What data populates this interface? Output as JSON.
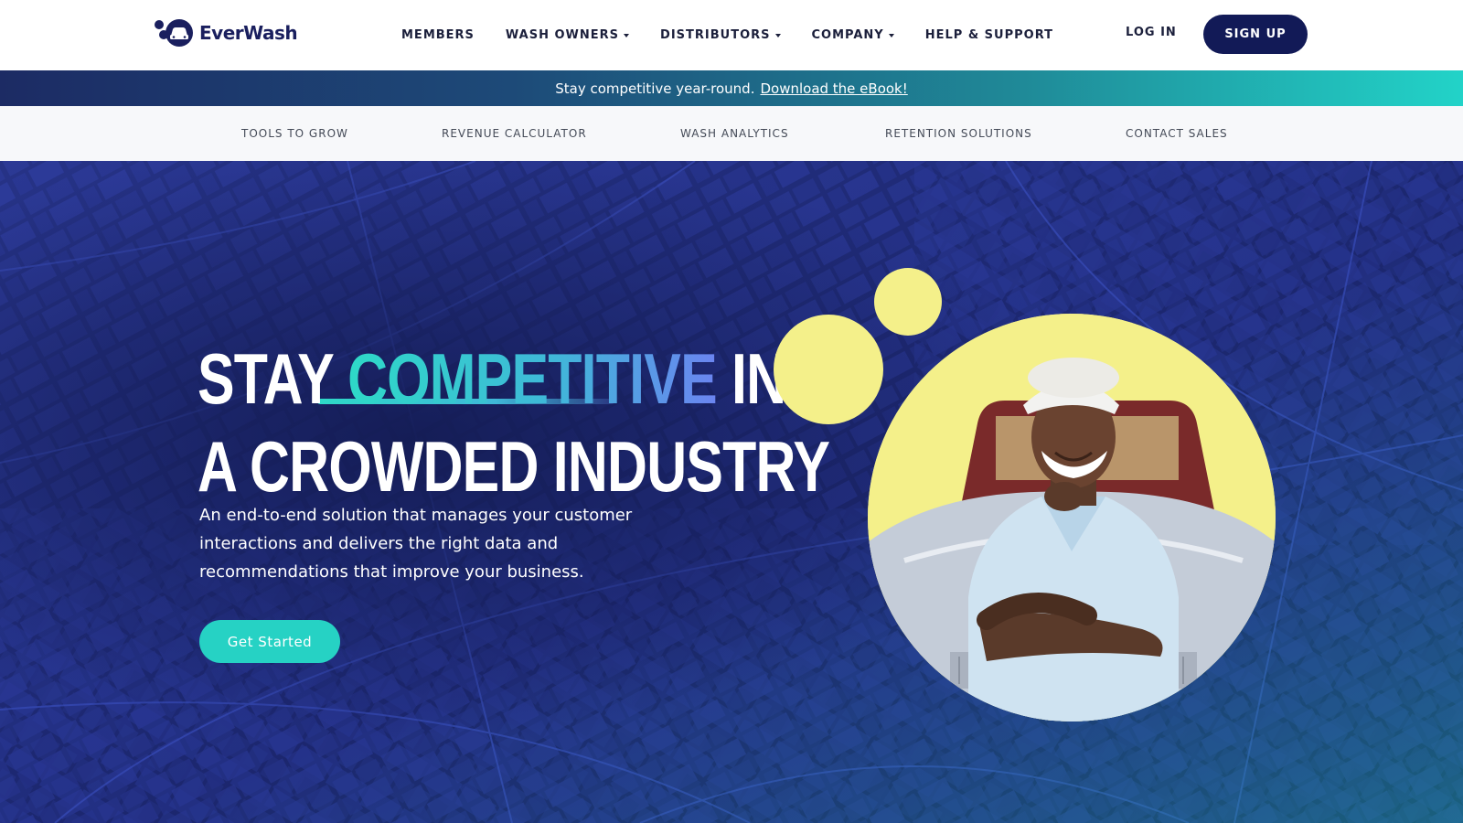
{
  "header": {
    "logo_text": "EverWash",
    "nav": [
      {
        "label": "MEMBERS",
        "dropdown": false
      },
      {
        "label": "WASH OWNERS",
        "dropdown": true
      },
      {
        "label": "DISTRIBUTORS",
        "dropdown": true
      },
      {
        "label": "COMPANY",
        "dropdown": true
      },
      {
        "label": "HELP & SUPPORT",
        "dropdown": false
      }
    ],
    "login_label": "LOG IN",
    "signup_label": "SIGN UP"
  },
  "banner": {
    "text": "Stay competitive year-round.",
    "link_text": "Download the eBook!"
  },
  "subnav": {
    "items": [
      "TOOLS TO GROW",
      "REVENUE CALCULATOR",
      "WASH ANALYTICS",
      "RETENTION SOLUTIONS",
      "CONTACT SALES"
    ]
  },
  "hero": {
    "headline_word1": "STAY",
    "headline_accent": "COMPETITIVE",
    "headline_word3": "IN",
    "headline_line2": "A CROWDED INDUSTRY",
    "subtext": "An end-to-end solution that manages your customer interactions and delivers the right data and recommendations that improve your business.",
    "cta_label": "Get Started"
  },
  "colors": {
    "navy": "#121a57",
    "hero_bg": "#141c54",
    "teal": "#26d2c4",
    "yellow": "#f4f08a"
  },
  "icons": [
    "everwash-logo-icon",
    "caret-down-icon"
  ]
}
